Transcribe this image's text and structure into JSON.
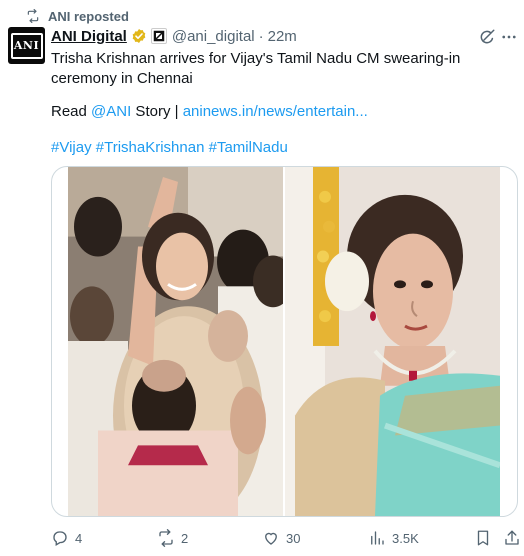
{
  "repost_label": "ANI reposted",
  "author": {
    "name": "ANI Digital",
    "handle": "@ani_digital",
    "separator": "·",
    "time": "22m",
    "avatar_text": "ANI"
  },
  "tweet": {
    "text": "Trisha Krishnan arrives for Vijay's Tamil Nadu CM swearing-in ceremony in Chennai",
    "read_prefix": "Read ",
    "read_mention": "@ANI",
    "read_middle": " Story | ",
    "read_link": "aninews.in/news/entertain...",
    "hashtags": [
      "#Vijay",
      "#TrishaKrishnan",
      "#TamilNadu"
    ]
  },
  "media": {
    "left_photo": "photo-waving",
    "right_photo": "photo-closeup"
  },
  "actions": {
    "replies": "4",
    "reposts": "2",
    "likes": "30",
    "views": "3.5K"
  },
  "colors": {
    "accent": "#1d9bf0",
    "muted": "#536471",
    "verified": "#e2b719",
    "saree": "#7fd3c8"
  },
  "icons": [
    "repost-icon",
    "verified-badge-icon",
    "affiliate-badge-icon",
    "grok-icon",
    "more-icon",
    "reply-icon",
    "like-icon",
    "views-icon",
    "bookmark-icon",
    "share-icon"
  ]
}
